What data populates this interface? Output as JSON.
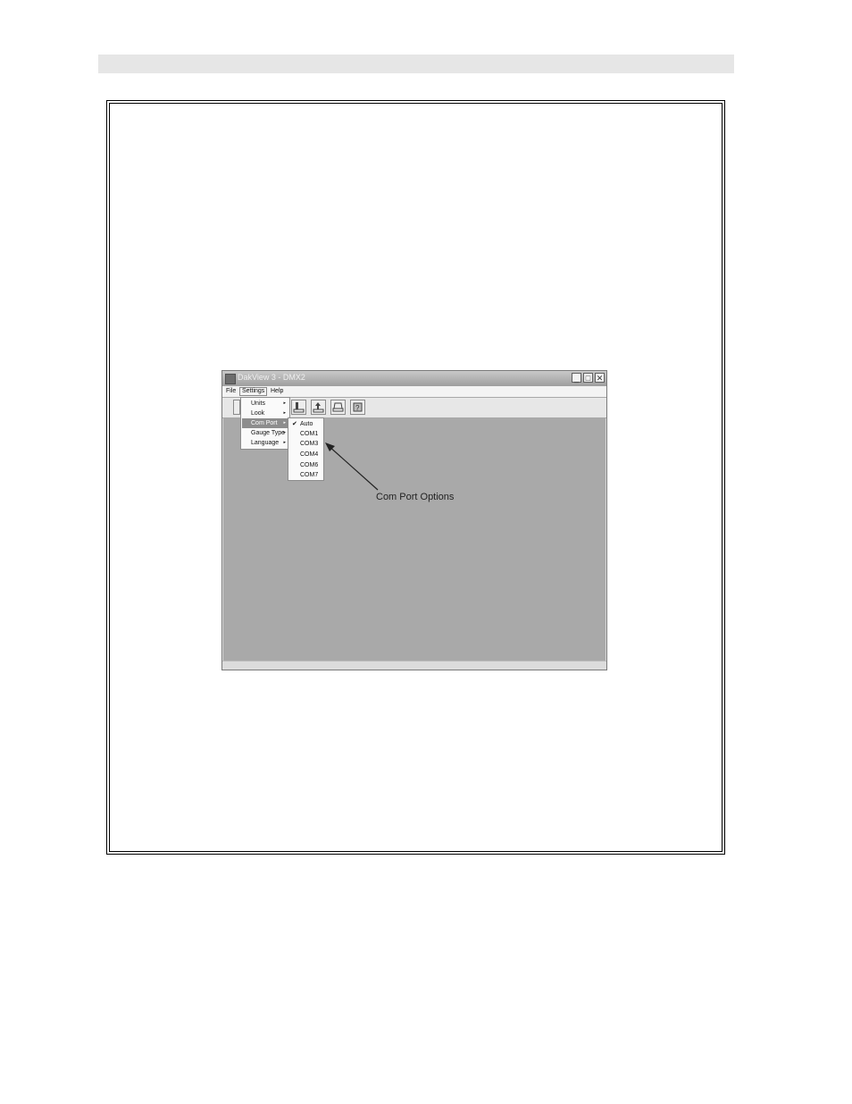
{
  "window": {
    "title": "DakView 3 - DMX2",
    "buttons": {
      "minimize": "_",
      "maximize": "□",
      "close": "✕"
    }
  },
  "menubar": {
    "items": [
      {
        "label": "File"
      },
      {
        "label": "Settings"
      },
      {
        "label": "Help"
      }
    ]
  },
  "settings_menu": {
    "items": [
      {
        "label": "Units",
        "submenu": true
      },
      {
        "label": "Look",
        "submenu": true
      },
      {
        "label": "Com Port",
        "submenu": true,
        "highlighted": true
      },
      {
        "label": "Gauge Type",
        "submenu": true
      },
      {
        "label": "Language",
        "submenu": true
      }
    ]
  },
  "com_port_submenu": {
    "items": [
      {
        "label": "Auto",
        "checked": true
      },
      {
        "label": "COM1"
      },
      {
        "label": "COM3"
      },
      {
        "label": "COM4"
      },
      {
        "label": "COM6"
      },
      {
        "label": "COM7"
      }
    ]
  },
  "annotation": {
    "text": "Com Port Options"
  },
  "icons": {
    "toolbar": [
      "blank-icon",
      "download-icon",
      "upload-icon",
      "print-icon",
      "help-icon"
    ],
    "arrow": "▸",
    "check": "✔"
  },
  "colors": {
    "client_area": "#a9a9a9",
    "menu_highlight": "#8d8d8d"
  }
}
